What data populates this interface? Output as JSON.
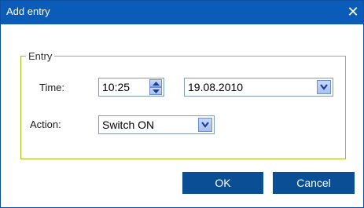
{
  "window": {
    "title": "Add entry"
  },
  "group": {
    "title": "Entry"
  },
  "time": {
    "label": "Time:",
    "value": "10:25"
  },
  "date": {
    "value": "19.08.2010"
  },
  "action": {
    "label": "Action:",
    "value": "Switch ON"
  },
  "buttons": {
    "ok": "OK",
    "cancel": "Cancel"
  },
  "icons": {
    "close": "close-icon",
    "spin_up": "arrow-up-icon",
    "spin_down": "arrow-down-icon",
    "dropdown": "chevron-down-icon"
  },
  "colors": {
    "titlebar": "#0b5cb8",
    "group_border": "#a0c11a",
    "button": "#0a4e96"
  }
}
